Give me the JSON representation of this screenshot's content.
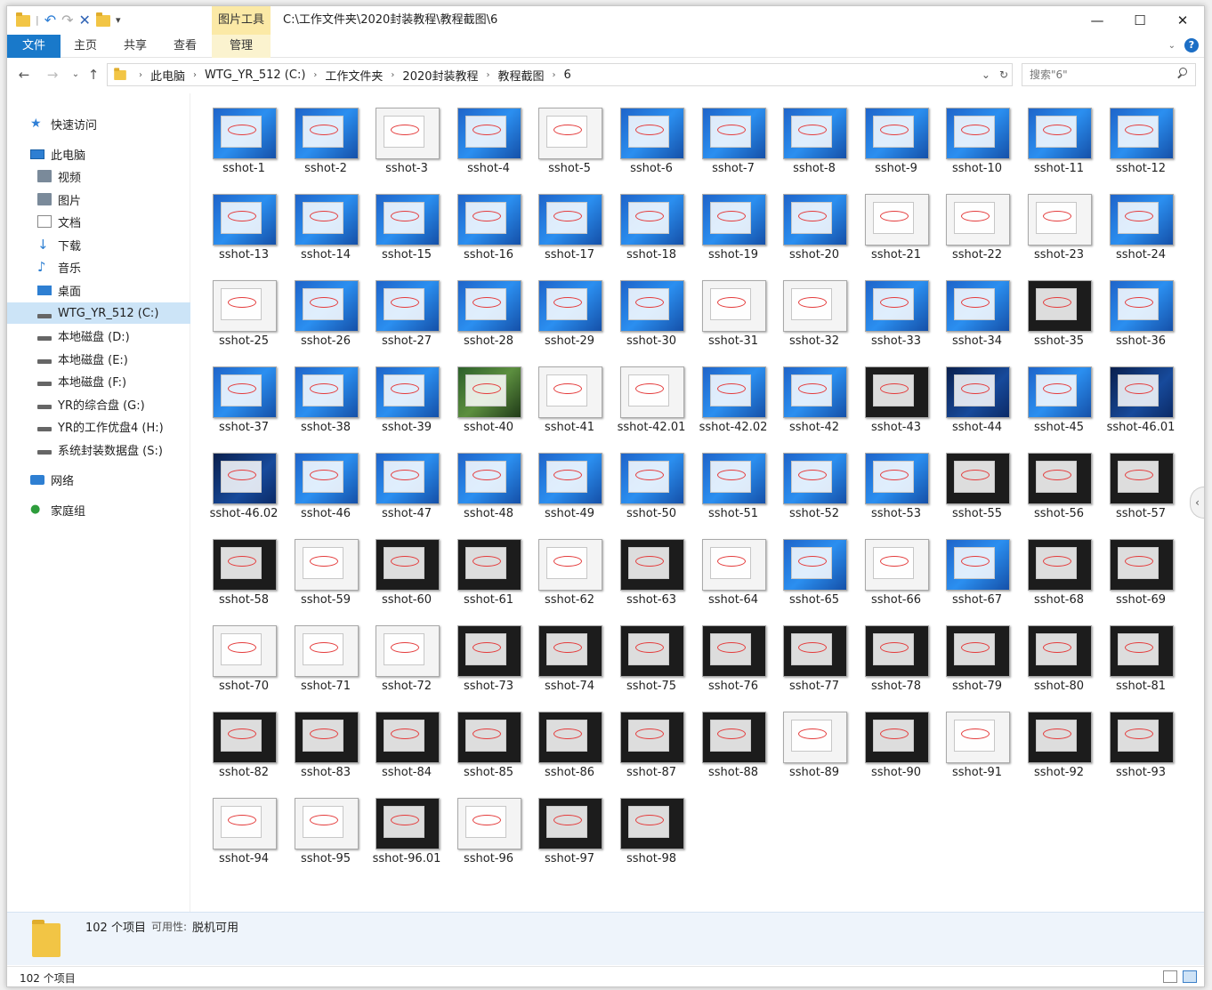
{
  "titlebar": {
    "quick_access": [
      "folder-icon",
      "undo-icon",
      "redo-icon",
      "delete-icon",
      "new-folder-icon",
      "customize-icon"
    ],
    "contextual_tab": "图片工具",
    "path": "C:\\工作文件夹\\2020封装教程\\教程截图\\6",
    "minimize": "—",
    "maximize": "☐",
    "close": "✕"
  },
  "ribbon": {
    "tabs": [
      {
        "label": "文件"
      },
      {
        "label": "主页"
      },
      {
        "label": "共享"
      },
      {
        "label": "查看"
      },
      {
        "label": "管理"
      }
    ],
    "help": "?"
  },
  "address": {
    "crumbs": [
      "此电脑",
      "WTG_YR_512 (C:)",
      "工作文件夹",
      "2020封装教程",
      "教程截图",
      "6"
    ],
    "search_placeholder": "搜索\"6\""
  },
  "sidebar": {
    "items": [
      {
        "label": "快速访问",
        "icon": "quick-access-icon",
        "indent": 1
      },
      {
        "label": "此电脑",
        "icon": "this-pc-icon",
        "indent": 1
      },
      {
        "label": "视频",
        "icon": "videos-icon",
        "indent": 2
      },
      {
        "label": "图片",
        "icon": "pictures-icon",
        "indent": 2
      },
      {
        "label": "文档",
        "icon": "documents-icon",
        "indent": 2
      },
      {
        "label": "下载",
        "icon": "downloads-icon",
        "indent": 2
      },
      {
        "label": "音乐",
        "icon": "music-icon",
        "indent": 2
      },
      {
        "label": "桌面",
        "icon": "desktop-icon",
        "indent": 2
      },
      {
        "label": "WTG_YR_512 (C:)",
        "icon": "drive-c-icon",
        "indent": 2,
        "selected": true
      },
      {
        "label": "本地磁盘 (D:)",
        "icon": "drive-icon",
        "indent": 2
      },
      {
        "label": "本地磁盘 (E:)",
        "icon": "drive-icon",
        "indent": 2
      },
      {
        "label": "本地磁盘 (F:)",
        "icon": "drive-icon",
        "indent": 2
      },
      {
        "label": "YR的综合盘 (G:)",
        "icon": "drive-icon",
        "indent": 2
      },
      {
        "label": "YR的工作优盘4 (H:)",
        "icon": "drive-icon",
        "indent": 2
      },
      {
        "label": "系统封装数据盘 (S:)",
        "icon": "drive-icon",
        "indent": 2
      },
      {
        "label": "网络",
        "icon": "network-icon",
        "indent": 1
      },
      {
        "label": "家庭组",
        "icon": "homegroup-icon",
        "indent": 1
      }
    ]
  },
  "files": [
    {
      "name": "sshot-1",
      "style": "blue"
    },
    {
      "name": "sshot-2",
      "style": "blue"
    },
    {
      "name": "sshot-3",
      "style": "white"
    },
    {
      "name": "sshot-4",
      "style": "blue"
    },
    {
      "name": "sshot-5",
      "style": "white"
    },
    {
      "name": "sshot-6",
      "style": "blue"
    },
    {
      "name": "sshot-7",
      "style": "blue"
    },
    {
      "name": "sshot-8",
      "style": "blue"
    },
    {
      "name": "sshot-9",
      "style": "blue"
    },
    {
      "name": "sshot-10",
      "style": "blue"
    },
    {
      "name": "sshot-11",
      "style": "blue"
    },
    {
      "name": "sshot-12",
      "style": "blue"
    },
    {
      "name": "sshot-13",
      "style": "blue"
    },
    {
      "name": "sshot-14",
      "style": "blue"
    },
    {
      "name": "sshot-15",
      "style": "blue"
    },
    {
      "name": "sshot-16",
      "style": "blue"
    },
    {
      "name": "sshot-17",
      "style": "blue"
    },
    {
      "name": "sshot-18",
      "style": "blue"
    },
    {
      "name": "sshot-19",
      "style": "blue"
    },
    {
      "name": "sshot-20",
      "style": "blue"
    },
    {
      "name": "sshot-21",
      "style": "white"
    },
    {
      "name": "sshot-22",
      "style": "white"
    },
    {
      "name": "sshot-23",
      "style": "white"
    },
    {
      "name": "sshot-24",
      "style": "blue"
    },
    {
      "name": "sshot-25",
      "style": "white"
    },
    {
      "name": "sshot-26",
      "style": "blue"
    },
    {
      "name": "sshot-27",
      "style": "blue"
    },
    {
      "name": "sshot-28",
      "style": "blue"
    },
    {
      "name": "sshot-29",
      "style": "blue"
    },
    {
      "name": "sshot-30",
      "style": "blue"
    },
    {
      "name": "sshot-31",
      "style": "white"
    },
    {
      "name": "sshot-32",
      "style": "white"
    },
    {
      "name": "sshot-33",
      "style": "blue"
    },
    {
      "name": "sshot-34",
      "style": "blue"
    },
    {
      "name": "sshot-35",
      "style": "dark"
    },
    {
      "name": "sshot-36",
      "style": "blue"
    },
    {
      "name": "sshot-37",
      "style": "blue"
    },
    {
      "name": "sshot-38",
      "style": "blue"
    },
    {
      "name": "sshot-39",
      "style": "blue"
    },
    {
      "name": "sshot-40",
      "style": "photo"
    },
    {
      "name": "sshot-41",
      "style": "white"
    },
    {
      "name": "sshot-42.01",
      "style": "white"
    },
    {
      "name": "sshot-42.02",
      "style": "blue"
    },
    {
      "name": "sshot-42",
      "style": "blue"
    },
    {
      "name": "sshot-43",
      "style": "dark"
    },
    {
      "name": "sshot-44",
      "style": "darkblue"
    },
    {
      "name": "sshot-45",
      "style": "blue"
    },
    {
      "name": "sshot-46.01",
      "style": "darkblue"
    },
    {
      "name": "sshot-46.02",
      "style": "darkblue"
    },
    {
      "name": "sshot-46",
      "style": "blue"
    },
    {
      "name": "sshot-47",
      "style": "blue"
    },
    {
      "name": "sshot-48",
      "style": "blue"
    },
    {
      "name": "sshot-49",
      "style": "blue"
    },
    {
      "name": "sshot-50",
      "style": "blue"
    },
    {
      "name": "sshot-51",
      "style": "blue"
    },
    {
      "name": "sshot-52",
      "style": "blue"
    },
    {
      "name": "sshot-53",
      "style": "blue"
    },
    {
      "name": "sshot-55",
      "style": "dark"
    },
    {
      "name": "sshot-56",
      "style": "dark"
    },
    {
      "name": "sshot-57",
      "style": "dark"
    },
    {
      "name": "sshot-58",
      "style": "dark"
    },
    {
      "name": "sshot-59",
      "style": "white"
    },
    {
      "name": "sshot-60",
      "style": "dark"
    },
    {
      "name": "sshot-61",
      "style": "dark"
    },
    {
      "name": "sshot-62",
      "style": "white"
    },
    {
      "name": "sshot-63",
      "style": "dark"
    },
    {
      "name": "sshot-64",
      "style": "white"
    },
    {
      "name": "sshot-65",
      "style": "blue"
    },
    {
      "name": "sshot-66",
      "style": "white"
    },
    {
      "name": "sshot-67",
      "style": "blue"
    },
    {
      "name": "sshot-68",
      "style": "dark"
    },
    {
      "name": "sshot-69",
      "style": "dark"
    },
    {
      "name": "sshot-70",
      "style": "white"
    },
    {
      "name": "sshot-71",
      "style": "white"
    },
    {
      "name": "sshot-72",
      "style": "white"
    },
    {
      "name": "sshot-73",
      "style": "dark"
    },
    {
      "name": "sshot-74",
      "style": "dark"
    },
    {
      "name": "sshot-75",
      "style": "dark"
    },
    {
      "name": "sshot-76",
      "style": "dark"
    },
    {
      "name": "sshot-77",
      "style": "dark"
    },
    {
      "name": "sshot-78",
      "style": "dark"
    },
    {
      "name": "sshot-79",
      "style": "dark"
    },
    {
      "name": "sshot-80",
      "style": "dark"
    },
    {
      "name": "sshot-81",
      "style": "dark"
    },
    {
      "name": "sshot-82",
      "style": "dark"
    },
    {
      "name": "sshot-83",
      "style": "dark"
    },
    {
      "name": "sshot-84",
      "style": "dark"
    },
    {
      "name": "sshot-85",
      "style": "dark"
    },
    {
      "name": "sshot-86",
      "style": "dark"
    },
    {
      "name": "sshot-87",
      "style": "dark"
    },
    {
      "name": "sshot-88",
      "style": "dark"
    },
    {
      "name": "sshot-89",
      "style": "white"
    },
    {
      "name": "sshot-90",
      "style": "dark"
    },
    {
      "name": "sshot-91",
      "style": "white"
    },
    {
      "name": "sshot-92",
      "style": "dark"
    },
    {
      "name": "sshot-93",
      "style": "dark"
    },
    {
      "name": "sshot-94",
      "style": "white"
    },
    {
      "name": "sshot-95",
      "style": "white"
    },
    {
      "name": "sshot-96.01",
      "style": "dark"
    },
    {
      "name": "sshot-96",
      "style": "white"
    },
    {
      "name": "sshot-97",
      "style": "dark"
    },
    {
      "name": "sshot-98",
      "style": "dark"
    }
  ],
  "details": {
    "count": "102 个项目",
    "availability_label": "可用性:",
    "availability_value": "脱机可用"
  },
  "status": {
    "count": "102 个项目"
  },
  "colors": {
    "file_tab": "#1979ca",
    "contextual_tab": "#fbe9a6",
    "selected": "#cce4f7",
    "accent": "#2e7fd2"
  }
}
